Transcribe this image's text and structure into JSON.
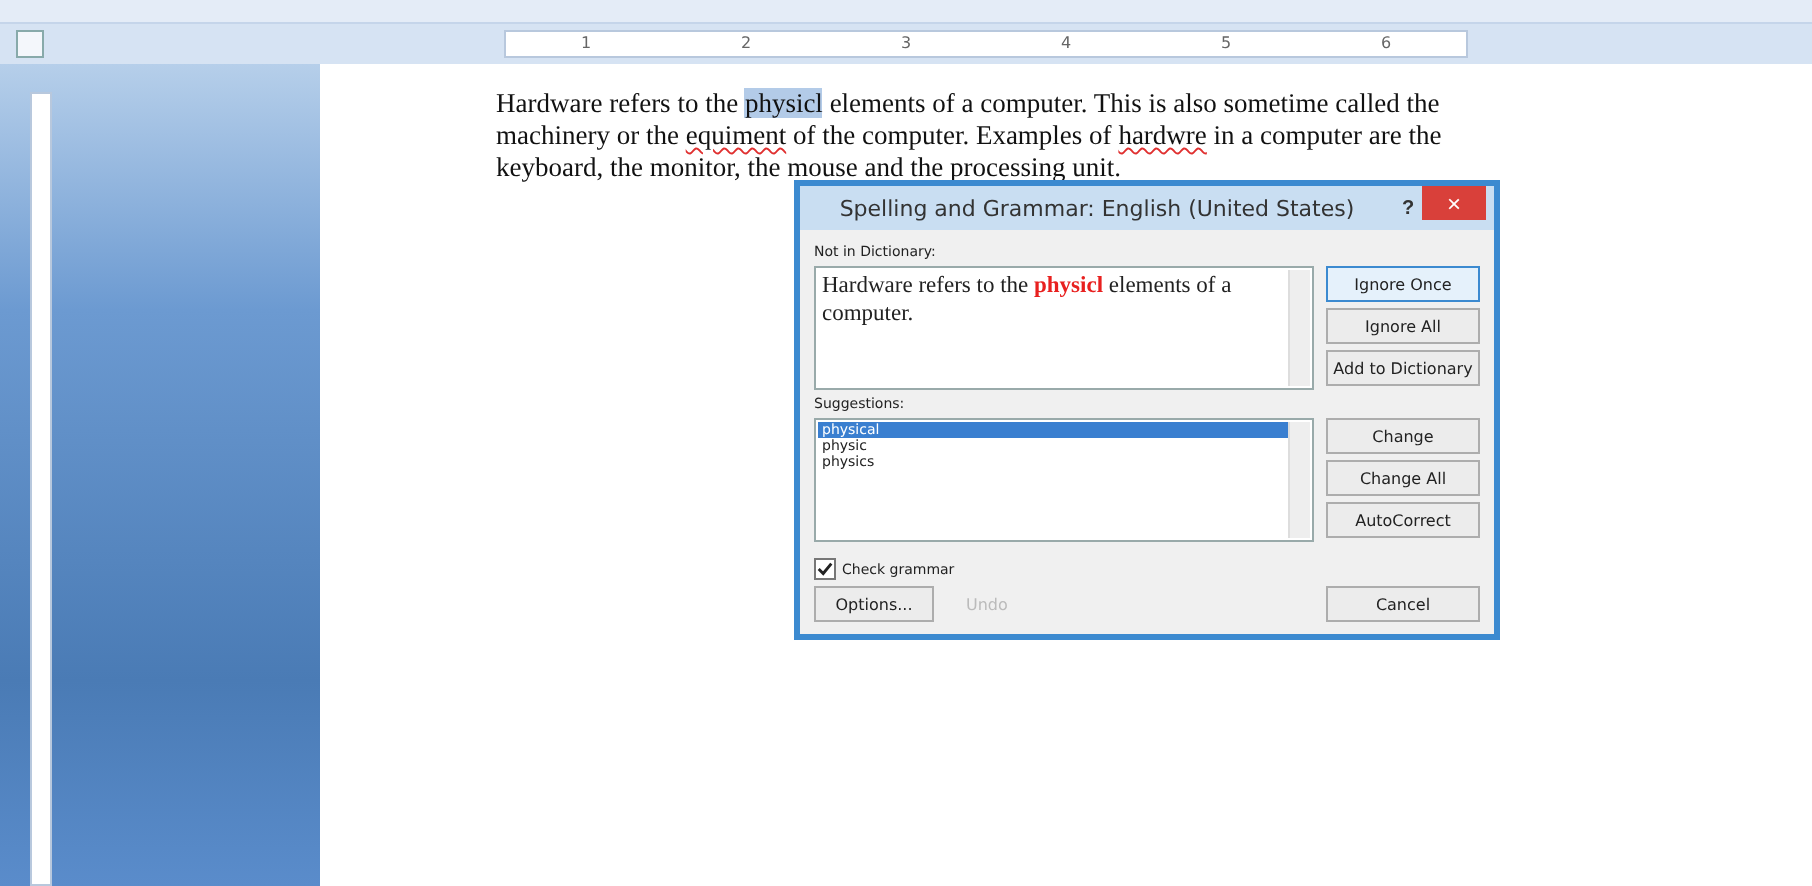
{
  "ruler": {
    "labels": [
      "1",
      "2",
      "3",
      "4",
      "5",
      "6"
    ]
  },
  "document": {
    "paragraph": [
      {
        "kind": "normal",
        "text": "Hardware refers to the "
      },
      {
        "kind": "selected",
        "text": "physicl"
      },
      {
        "kind": "normal",
        "text": " elements of a computer. This is also sometime called the machinery or the "
      },
      {
        "kind": "misspelled",
        "text": "equiment"
      },
      {
        "kind": "normal",
        "text": " of the computer. Examples of "
      },
      {
        "kind": "misspelled",
        "text": "hardwre"
      },
      {
        "kind": "normal",
        "text": " in a computer are the keyboard, the monitor, the mouse and the processing unit."
      }
    ]
  },
  "dialog": {
    "title": "Spelling and Grammar: English (United States)",
    "help": "?",
    "close": "×",
    "not_in_dictionary_label": "Not in Dictionary:",
    "sentence": [
      {
        "kind": "normal",
        "text": "Hardware refers to the "
      },
      {
        "kind": "error",
        "text": "physicl"
      },
      {
        "kind": "normal",
        "text": " elements of a computer."
      }
    ],
    "top_buttons": [
      {
        "label": "Ignore Once",
        "selected": true
      },
      {
        "label": "Ignore All",
        "selected": false
      },
      {
        "label": "Add to Dictionary",
        "selected": false
      }
    ],
    "suggestions_label": "Suggestions:",
    "suggestions": [
      {
        "text": "physical",
        "selected": true
      },
      {
        "text": "physic",
        "selected": false
      },
      {
        "text": "physics",
        "selected": false
      }
    ],
    "change_buttons": [
      {
        "label": "Change"
      },
      {
        "label": "Change All"
      },
      {
        "label": "AutoCorrect"
      }
    ],
    "check_grammar": {
      "label": "Check grammar",
      "checked": true
    },
    "options_button": {
      "label": "Options...",
      "disabled": false
    },
    "undo_button": {
      "label": "Undo",
      "disabled": true
    },
    "cancel_button": {
      "label": "Cancel"
    }
  }
}
